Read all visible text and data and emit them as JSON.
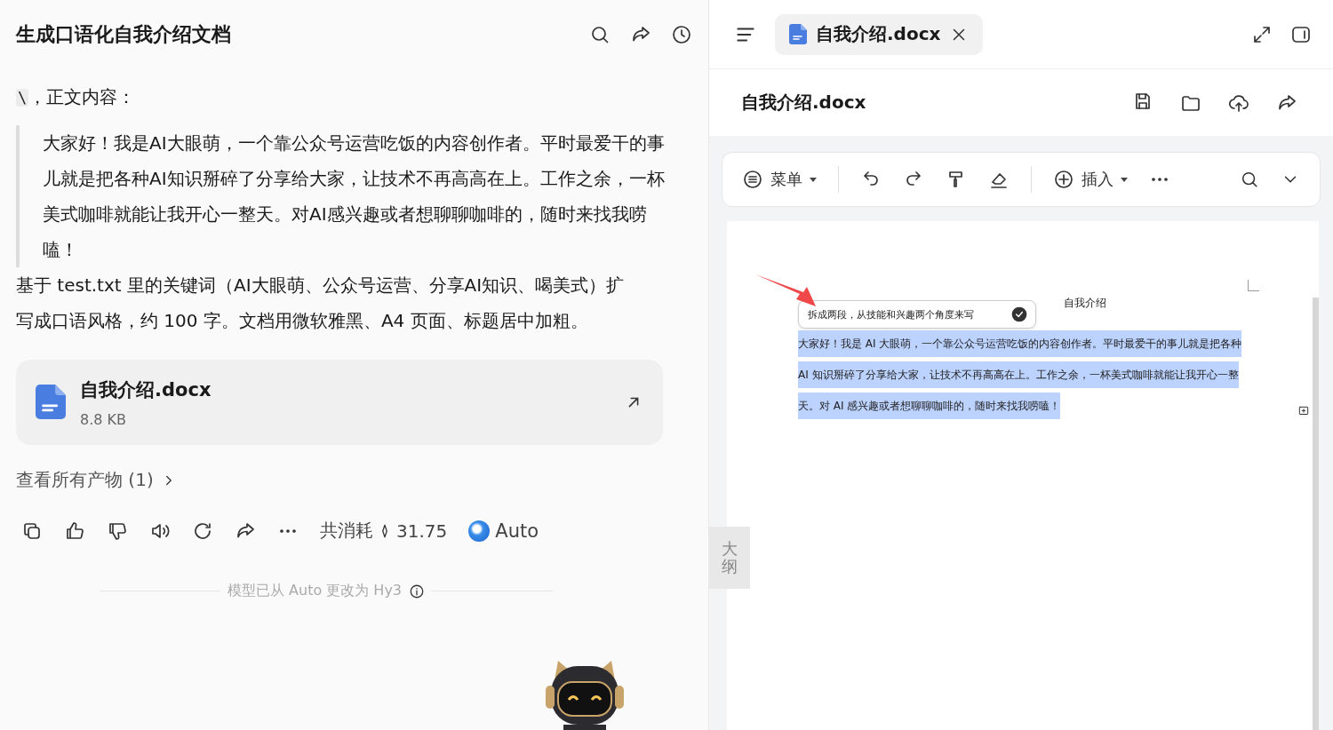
{
  "chat": {
    "title": "生成口语化自我介绍文档",
    "intro": {
      "code": "\\",
      "text": "，正文内容："
    },
    "quote": "大家好！我是AI大眼萌，一个靠公众号运营吃饭的内容创作者。平时最爱干的事儿就是把各种AI知识掰碎了分享给大家，让技术不再高高在上。工作之余，一杯美式咖啡就能让我开心一整天。对AI感兴趣或者想聊聊咖啡的，随时来找我唠嗑！",
    "request": "基于 test.txt 里的关键词（AI大眼萌、公众号运营、分享AI知识、喝美式）扩写成口语风格，约 100 字。文档用微软雅黑、A4 页面、标题居中加粗。",
    "file": {
      "name": "自我介绍.docx",
      "size": "8.8 KB"
    },
    "artifacts_link": "查看所有产物 (1)",
    "cost_label": "共消耗",
    "cost": "31.75",
    "model": "Auto",
    "notice": "模型已从 Auto 更改为 Hy3"
  },
  "editor": {
    "tab": {
      "title": "自我介绍.docx",
      "selected": true
    },
    "doc_title": "自我介绍.docx",
    "toolbar": {
      "menu": "菜单",
      "insert": "插入"
    },
    "outline_label": "大纲",
    "page": {
      "heading": "自我介绍",
      "prompt": "拆成两段，从技能和兴趣两个角度来写",
      "body": "大家好！我是 AI 大眼萌，一个靠公众号运营吃饭的内容创作者。平时最爱干的事儿就是把各种 AI 知识掰碎了分享给大家，让技术不再高高在上。工作之余，一杯美式咖啡就能让我开心一整天。对 AI 感兴趣或者想聊聊咖啡的，随时来找我唠嗑！",
      "selected": true
    }
  }
}
